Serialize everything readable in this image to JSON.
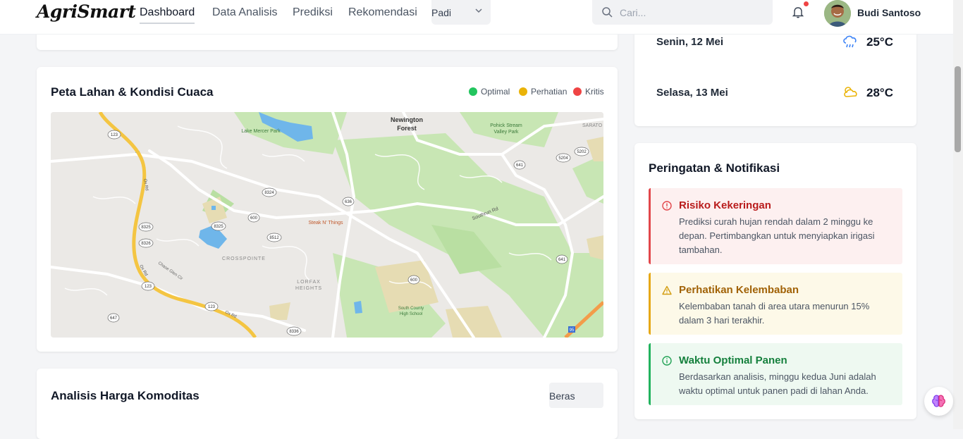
{
  "app": {
    "logo": "AgriSmart"
  },
  "nav": {
    "items": [
      "Dashboard",
      "Data Analisis",
      "Prediksi",
      "Rekomendasi"
    ],
    "active": "Dashboard",
    "crop_select": "Padi"
  },
  "search": {
    "placeholder": "Cari..."
  },
  "user": {
    "name": "Budi Santoso"
  },
  "map_card": {
    "title": "Peta Lahan & Kondisi Cuaca",
    "legend": [
      {
        "label": "Optimal",
        "color": "#22c55e"
      },
      {
        "label": "Perhatian",
        "color": "#eab308"
      },
      {
        "label": "Kritis",
        "color": "#ef4444"
      }
    ],
    "map_labels": {
      "forest1": "Newington",
      "forest2": "Forest",
      "lake": "Lake Mercer Park",
      "park1": "Pohick Stream",
      "park2": "Valley Park",
      "saratoga": "SARATO",
      "steak": "Steak N' Things",
      "southrun": "Southrun Rd",
      "crosspointe": "CROSSPOINTE",
      "lorfax1": "LORFAX",
      "lorfax2": "HEIGHTS",
      "school1": "South County",
      "school2": "High School",
      "chase": "Chase Glen Cir",
      "oxrd1": "Ox Rd",
      "oxrd2": "Ox Rd",
      "oxrd3": "Ox Rd",
      "shields": [
        "123",
        "123",
        "123",
        "8324",
        "636",
        "600",
        "8512",
        "8325",
        "8325",
        "8326",
        "641",
        "641",
        "600",
        "8336",
        "8336",
        "647",
        "5202",
        "5204",
        "95"
      ]
    }
  },
  "weather": {
    "days": [
      {
        "day": "Senin, 12 Mei",
        "icon": "rain-cloud-icon",
        "temp": "25°C"
      },
      {
        "day": "Selasa, 13 Mei",
        "icon": "partly-cloudy-icon",
        "temp": "28°C"
      }
    ]
  },
  "alerts_card": {
    "title": "Peringatan & Notifikasi",
    "items": [
      {
        "type": "red",
        "icon": "alert-circle-icon",
        "title": "Risiko Kekeringan",
        "text": "Prediksi curah hujan rendah dalam 2 minggu ke depan. Pertimbangkan untuk menyiapkan irigasi tambahan."
      },
      {
        "type": "yellow",
        "icon": "warning-triangle-icon",
        "title": "Perhatikan Kelembaban",
        "text": "Kelembaban tanah di area utara menurun 15% dalam 3 hari terakhir."
      },
      {
        "type": "green",
        "icon": "info-circle-icon",
        "title": "Waktu Optimal Panen",
        "text": "Berdasarkan analisis, minggu kedua Juni adalah waktu optimal untuk panen padi di lahan Anda."
      }
    ]
  },
  "price_card": {
    "title": "Analisis Harga Komoditas",
    "select": "Beras"
  },
  "colors": {
    "red": "#e2474b",
    "yellow": "#e6a817",
    "green": "#22b35e",
    "map_road": "#f4c542",
    "map_green": "#c8e6b4"
  }
}
